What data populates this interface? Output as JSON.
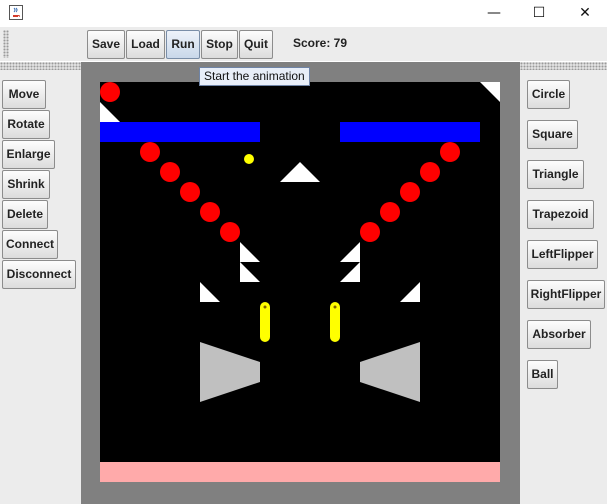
{
  "window": {
    "controls": {
      "minimize": "—",
      "maximize": "☐",
      "close": "✕"
    },
    "icon": "java-cup-icon"
  },
  "toolbar": {
    "buttons": [
      {
        "label": "Save"
      },
      {
        "label": "Load"
      },
      {
        "label": "Run"
      },
      {
        "label": "Stop"
      },
      {
        "label": "Quit"
      }
    ],
    "score_text": "Score: 79"
  },
  "tooltip": {
    "text": "Start the animation"
  },
  "left_tools": [
    "Move",
    "Rotate",
    "Enlarge",
    "Shrink",
    "Delete",
    "Connect",
    "Disconnect"
  ],
  "right_tools": [
    "Circle",
    "Square",
    "Triangle",
    "Trapezoid",
    "LeftFlipper",
    "RightFlipper",
    "Absorber",
    "Ball"
  ],
  "colors": {
    "board_background": "#000000",
    "frame": "#808080",
    "circle_bumper": "#ff0000",
    "square_bar": "#0000ff",
    "triangle_bumper": "#ffffff",
    "trapezoid_bumper": "#c0c0c0",
    "flipper": "#ffff00",
    "ball": "#ffff00",
    "absorber": "#ffaaaa"
  }
}
